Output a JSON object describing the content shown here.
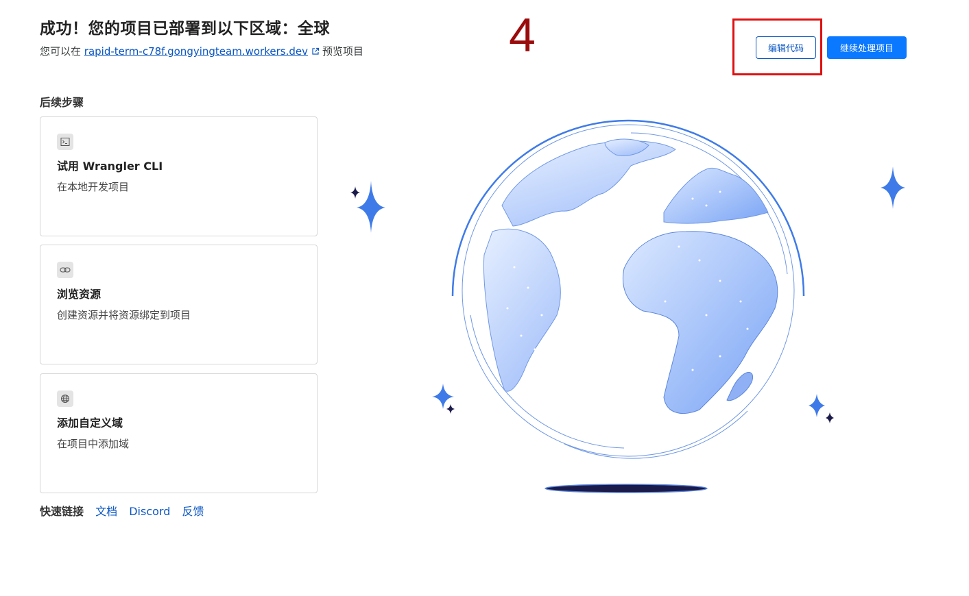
{
  "header": {
    "title": "成功！您的项目已部署到以下区域：全球",
    "subtitle_prefix": "您可以在",
    "url": "rapid-term-c78f.gongyingteam.workers.dev",
    "preview_label": "预览项目",
    "external_icon": "external-link-icon"
  },
  "annotation": {
    "step_number": "4",
    "highlight_color": "#e01010"
  },
  "actions": {
    "edit_code": "编辑代码",
    "continue_project": "继续处理项目"
  },
  "next_steps": {
    "title": "后续步骤",
    "cards": [
      {
        "icon": "terminal-icon",
        "title": "试用 Wrangler CLI",
        "description": "在本地开发项目"
      },
      {
        "icon": "link-icon",
        "title": "浏览资源",
        "description": "创建资源并将资源绑定到项目"
      },
      {
        "icon": "globe-icon",
        "title": "添加自定义域",
        "description": "在项目中添加域"
      }
    ]
  },
  "quick_links": {
    "label": "快速链接",
    "links": [
      "文档",
      "Discord",
      "反馈"
    ]
  },
  "illustration": {
    "icon": "globe-illustration",
    "colors": {
      "primary": "#3f7be8",
      "light": "#cfe0ff",
      "dark": "#1b1b4b"
    }
  },
  "colors": {
    "link": "#0a56c2",
    "primary_button": "#0a78ff",
    "step_number": "#9a0b0b"
  }
}
